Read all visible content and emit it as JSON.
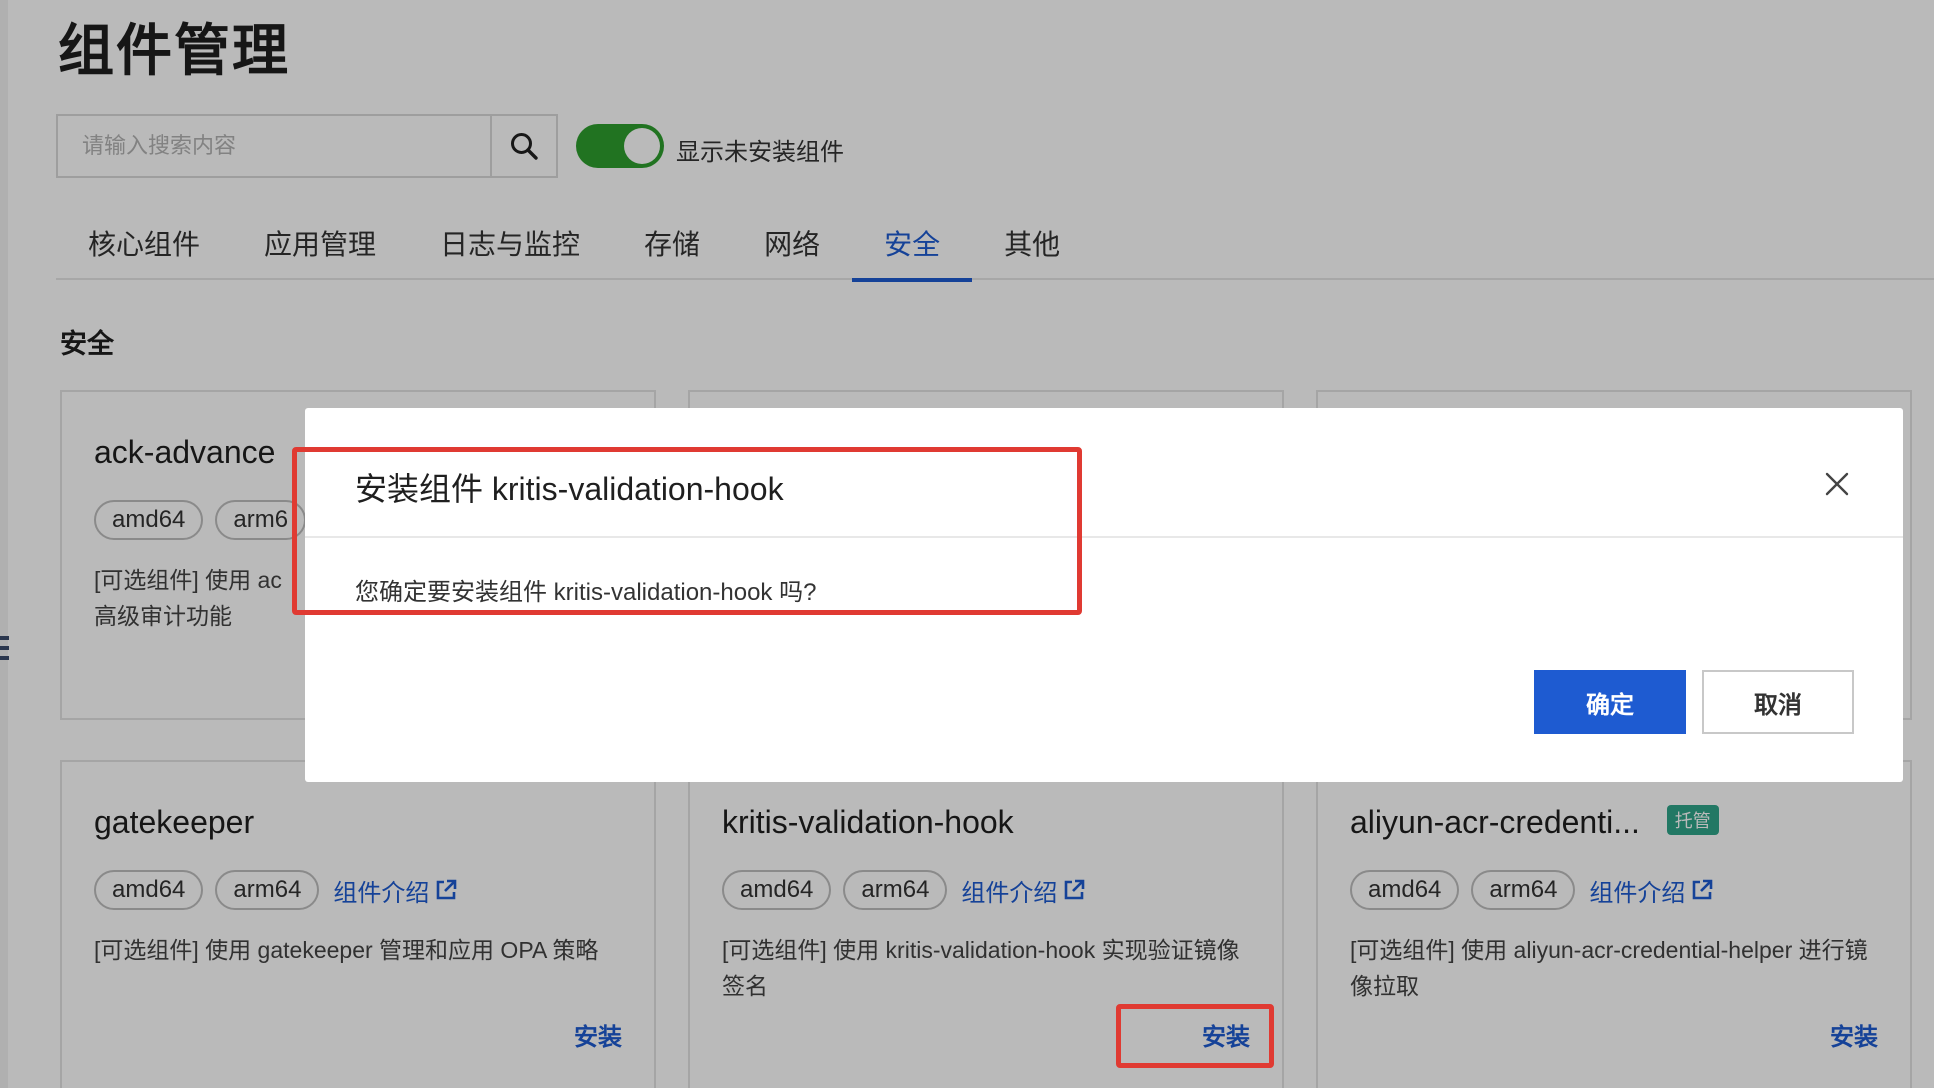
{
  "page": {
    "title": "组件管理"
  },
  "search": {
    "placeholder": "请输入搜索内容"
  },
  "toggle": {
    "label": "显示未安装组件",
    "on": true
  },
  "tabs": [
    {
      "label": "核心组件"
    },
    {
      "label": "应用管理"
    },
    {
      "label": "日志与监控"
    },
    {
      "label": "存储"
    },
    {
      "label": "网络"
    },
    {
      "label": "安全",
      "active": true
    },
    {
      "label": "其他"
    }
  ],
  "section": {
    "title": "安全"
  },
  "cards": [
    {
      "name": "ack-advance",
      "tags": [
        "amd64",
        "arm6"
      ],
      "desc": "[可选组件] 使用 ac",
      "desc2": "高级审计功能"
    },
    {
      "name": "gatekeeper",
      "tags": [
        "amd64",
        "arm64"
      ],
      "intro": "组件介绍",
      "desc": "[可选组件] 使用 gatekeeper 管理和应用 OPA 策略",
      "install": "安装"
    },
    {
      "name": "kritis-validation-hook",
      "tags": [
        "amd64",
        "arm64"
      ],
      "intro": "组件介绍",
      "desc": "[可选组件] 使用 kritis-validation-hook 实现验证镜像签名",
      "install": "安装"
    },
    {
      "name": "aliyun-acr-credenti...",
      "badge": "托管",
      "tags": [
        "amd64",
        "arm64"
      ],
      "intro": "组件介绍",
      "desc": "[可选组件] 使用 aliyun-acr-credential-helper 进行镜像拉取",
      "install": "安装"
    }
  ],
  "dialog": {
    "title": "安装组件 kritis-validation-hook",
    "message": "您确定要安装组件 kritis-validation-hook 吗?",
    "confirm": "确定",
    "cancel": "取消"
  },
  "colors": {
    "primary": "#1e5bd1",
    "toggle_on": "#2e9e2e",
    "badge": "#2fa58a",
    "highlight": "#e03a32"
  }
}
